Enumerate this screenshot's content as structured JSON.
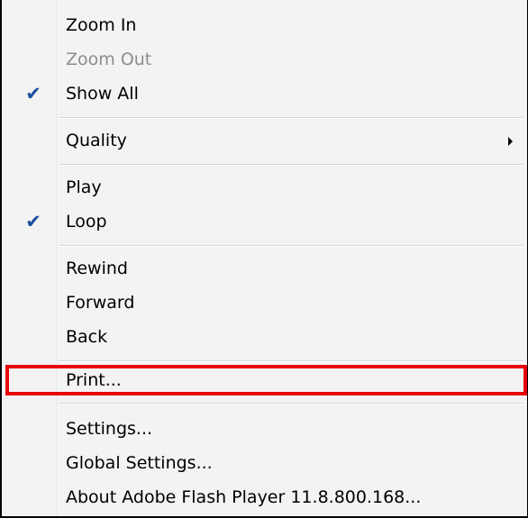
{
  "menu": {
    "items": [
      {
        "id": "zoom-in",
        "label": "Zoom In",
        "enabled": true,
        "checked": false
      },
      {
        "id": "zoom-out",
        "label": "Zoom Out",
        "enabled": false,
        "checked": false
      },
      {
        "id": "show-all",
        "label": "Show All",
        "enabled": true,
        "checked": true
      },
      {
        "id": "quality",
        "label": "Quality",
        "enabled": true,
        "checked": false,
        "submenu": true
      },
      {
        "id": "play",
        "label": "Play",
        "enabled": true,
        "checked": false
      },
      {
        "id": "loop",
        "label": "Loop",
        "enabled": true,
        "checked": true
      },
      {
        "id": "rewind",
        "label": "Rewind",
        "enabled": true,
        "checked": false
      },
      {
        "id": "forward",
        "label": "Forward",
        "enabled": true,
        "checked": false
      },
      {
        "id": "back",
        "label": "Back",
        "enabled": true,
        "checked": false
      },
      {
        "id": "print",
        "label": "Print...",
        "enabled": true,
        "checked": false
      },
      {
        "id": "settings",
        "label": "Settings...",
        "enabled": true,
        "checked": false
      },
      {
        "id": "global-settings",
        "label": "Global Settings...",
        "enabled": true,
        "checked": false
      },
      {
        "id": "about",
        "label": "About Adobe Flash Player 11.8.800.168...",
        "enabled": true,
        "checked": false
      }
    ],
    "highlighted_item": "print"
  },
  "colors": {
    "menu_background": "#f3f3f3",
    "disabled_text": "#8d8d8d",
    "check_mark": "#1a4fa0",
    "highlight_border": "#e8000b"
  },
  "icons": {
    "check": "check-icon",
    "submenu": "submenu-arrow-icon"
  }
}
